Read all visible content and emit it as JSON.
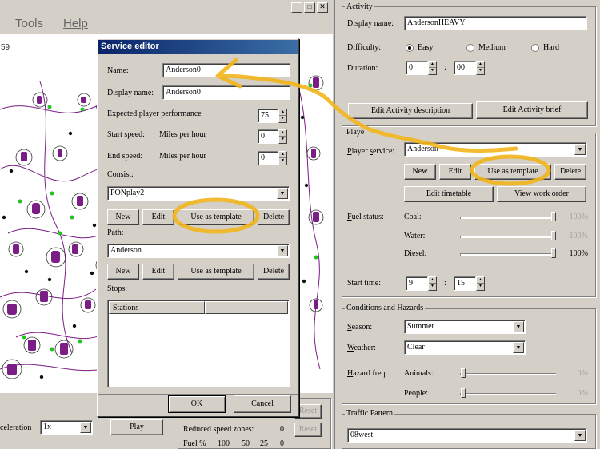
{
  "main_window": {
    "menu": [
      "Tools",
      "Help"
    ],
    "map_label": "59",
    "bottom": {
      "acceleration_label": "celeration",
      "acceleration_value": "1x",
      "play_label": "Play",
      "reset_label_1": "Reset",
      "reset_label_2": "Reset",
      "reduced_speed_label": "Reduced speed zones:",
      "reduced_speed_value": "0",
      "fuel_label": "Fuel %",
      "fuel_values": [
        "100",
        "50",
        "25",
        "0"
      ]
    }
  },
  "service_editor": {
    "title": "Service editor",
    "name_label": "Name:",
    "name_value": "Anderson0",
    "display_name_label": "Display name:",
    "display_name_value": "Anderson0",
    "expected_perf_label": "Expected player performance",
    "expected_perf_value": "75",
    "start_speed_label": "Start speed:",
    "end_speed_label": "End speed:",
    "speed_unit": "Miles per hour",
    "start_speed_value": "0",
    "end_speed_value": "0",
    "consist_label": "Consist:",
    "consist_value": "PONplay2",
    "consist_buttons": [
      "New",
      "Edit",
      "Use as template",
      "Delete"
    ],
    "path_label": "Path:",
    "path_value": "Anderson",
    "path_buttons": [
      "New",
      "Edit",
      "Use as template",
      "Delete"
    ],
    "stops_label": "Stops:",
    "stations_header": "Stations",
    "ok_label": "OK",
    "cancel_label": "Cancel"
  },
  "activity": {
    "title": "Activity",
    "display_name_label": "Display name:",
    "display_name_value": "AndersonHEAVY",
    "difficulty_label": "Difficulty:",
    "difficulty_options": [
      "Easy",
      "Medium",
      "Hard"
    ],
    "difficulty_selected": "Easy",
    "duration_label": "Duration:",
    "duration_hours": "0",
    "duration_minutes": "00",
    "edit_description_label": "Edit Activity description",
    "edit_brief_label": "Edit Activity brief"
  },
  "player": {
    "title": "Playe",
    "service_label": "Player service:",
    "service_value": "Anderson",
    "service_buttons": [
      "New",
      "Edit",
      "Use as template",
      "Delete"
    ],
    "edit_timetable_label": "Edit timetable",
    "view_work_order_label": "View work order",
    "fuel_status_label": "Fuel status:",
    "fuel_items": [
      {
        "label": "Coal:",
        "value": "100%",
        "level": 1.0
      },
      {
        "label": "Water:",
        "value": "100%",
        "level": 1.0
      },
      {
        "label": "Diesel:",
        "value": "100%",
        "level": 1.0
      }
    ],
    "start_time_label": "Start time:",
    "start_hour": "9",
    "start_minute": "15"
  },
  "conditions": {
    "title": "Conditions and Hazards",
    "season_label": "Season:",
    "season_value": "Summer",
    "weather_label": "Weather:",
    "weather_value": "Clear",
    "hazard_label": "Hazard freq:",
    "animals_label": "Animals:",
    "animals_value": "0%",
    "people_label": "People:",
    "people_value": "0%"
  },
  "traffic": {
    "title": "Traffic Pattern",
    "value": "08west"
  },
  "colors": {
    "annotation": "#f2b51c",
    "titlebar": "#0a246a",
    "map_track": "#7a1e86",
    "map_node": "#22c322"
  }
}
